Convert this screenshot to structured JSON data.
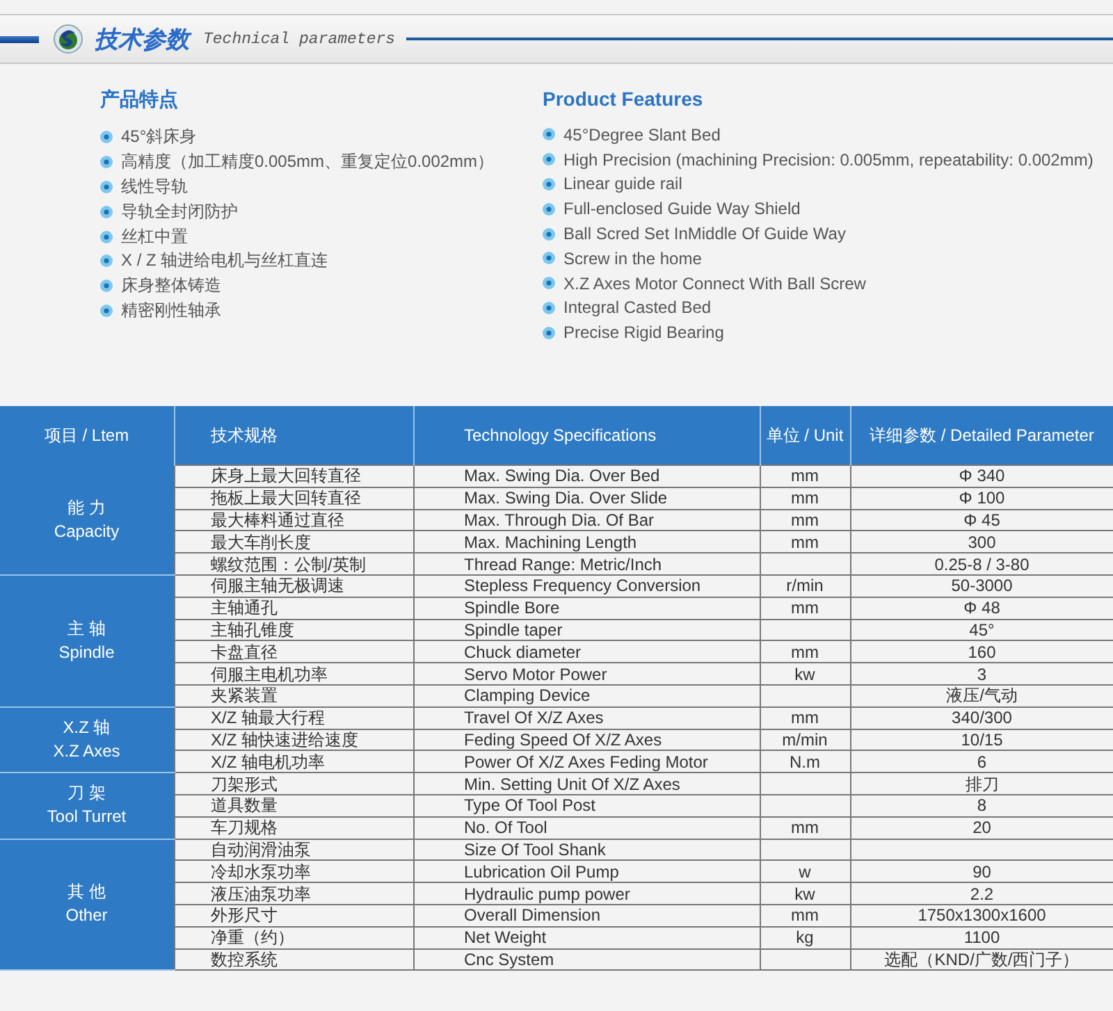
{
  "header": {
    "title": "技术参数",
    "subtitle": "Technical parameters"
  },
  "features": [
    {
      "title": "产品特点",
      "items": [
        "45°斜床身",
        "高精度（加工精度0.005mm、重复定位0.002mm）",
        "线性导轨",
        "导轨全封闭防护",
        "丝杠中置",
        "X / Z 轴进给电机与丝杠直连",
        "床身整体铸造",
        "精密刚性轴承"
      ]
    },
    {
      "title": "Product Features",
      "items": [
        "45°Degree Slant Bed",
        "High Precision (machining Precision: 0.005mm, repeatability: 0.002mm)",
        "Linear guide rail",
        "Full-enclosed Guide Way Shield",
        "Ball Scred Set InMiddle Of Guide Way",
        "Screw in the home",
        "X.Z Axes Motor Connect With Ball Screw",
        "Integral Casted Bed",
        "Precise Rigid Bearing"
      ]
    }
  ],
  "table": {
    "columns": [
      "项目 / Ltem",
      "技术规格",
      "Technology Specifications",
      "单位 / Unit",
      "详细参数 / Detailed Parameter"
    ],
    "groups": [
      {
        "name_zh": "能 力",
        "name_en": "Capacity",
        "rows": [
          {
            "spec_zh": "床身上最大回转直径",
            "spec_en": "Max. Swing Dia. Over Bed",
            "unit": "mm",
            "value": "Φ 340"
          },
          {
            "spec_zh": "拖板上最大回转直径",
            "spec_en": "Max. Swing Dia. Over Slide",
            "unit": "mm",
            "value": "Φ 100"
          },
          {
            "spec_zh": "最大棒料通过直径",
            "spec_en": "Max. Through Dia. Of Bar",
            "unit": "mm",
            "value": "Φ 45"
          },
          {
            "spec_zh": "最大车削长度",
            "spec_en": "Max. Machining Length",
            "unit": "mm",
            "value": "300"
          },
          {
            "spec_zh": "螺纹范围：公制/英制",
            "spec_en": "Thread Range: Metric/Inch",
            "value": "0.25-8 / 3-80"
          }
        ]
      },
      {
        "name_zh": "主 轴",
        "name_en": "Spindle",
        "rows": [
          {
            "spec_zh": "伺服主轴无极调速",
            "spec_en": "Stepless Frequency Conversion",
            "unit": "r/min",
            "value": "50-3000"
          },
          {
            "spec_zh": "主轴通孔",
            "spec_en": "Spindle Bore",
            "unit": "mm",
            "value": "Φ 48"
          },
          {
            "spec_zh": "主轴孔锥度",
            "spec_en": "Spindle taper",
            "value": "45°"
          },
          {
            "spec_zh": "卡盘直径",
            "spec_en": "Chuck diameter",
            "unit": "mm",
            "value": "160"
          },
          {
            "spec_zh": "伺服主电机功率",
            "spec_en": "Servo Motor Power",
            "unit": "kw",
            "value": "3"
          },
          {
            "spec_zh": "夹紧装置",
            "spec_en": "Clamping Device",
            "value": "液压/气动"
          }
        ]
      },
      {
        "name_zh": "X.Z 轴",
        "name_en": "X.Z Axes",
        "rows": [
          {
            "spec_zh": "X/Z 轴最大行程",
            "spec_en": "Travel Of X/Z Axes",
            "unit": "mm",
            "value": "340/300"
          },
          {
            "spec_zh": "X/Z 轴快速进给速度",
            "spec_en": "Feding Speed Of X/Z Axes",
            "unit": "m/min",
            "value": "10/15"
          },
          {
            "spec_zh": "X/Z 轴电机功率",
            "spec_en": "Power Of X/Z Axes Feding Motor",
            "unit": "N.m",
            "value": "6"
          }
        ]
      },
      {
        "name_zh": "刀 架",
        "name_en": "Tool Turret",
        "rows": [
          {
            "spec_zh": "刀架形式",
            "spec_en": "Min. Setting Unit Of X/Z Axes",
            "value": "排刀"
          },
          {
            "spec_zh": "道具数量",
            "spec_en": "Type Of Tool Post",
            "value": "8"
          },
          {
            "spec_zh": "车刀规格",
            "spec_en": "No. Of Tool",
            "unit": "mm",
            "value": "20"
          }
        ]
      },
      {
        "name_zh": "其 他",
        "name_en": "Other",
        "rows": [
          {
            "spec_zh": "自动润滑油泵",
            "spec_en": "Size Of Tool Shank"
          },
          {
            "spec_zh": "冷却水泵功率",
            "spec_en": "Lubrication Oil Pump",
            "unit": "w",
            "value": "90"
          },
          {
            "spec_zh": "液压油泵功率",
            "spec_en": "Hydraulic pump power",
            "unit": "kw",
            "value": "2.2"
          },
          {
            "spec_zh": "外形尺寸",
            "spec_en": "Overall Dimension",
            "unit": "mm",
            "value": "1750x1300x1600"
          },
          {
            "spec_zh": "净重（约）",
            "spec_en": "Net Weight",
            "unit": "kg",
            "value": "1100"
          },
          {
            "spec_zh": "数控系统",
            "spec_en": "Cnc System",
            "value": "选配（KND/广数/西门子）"
          }
        ]
      }
    ]
  }
}
